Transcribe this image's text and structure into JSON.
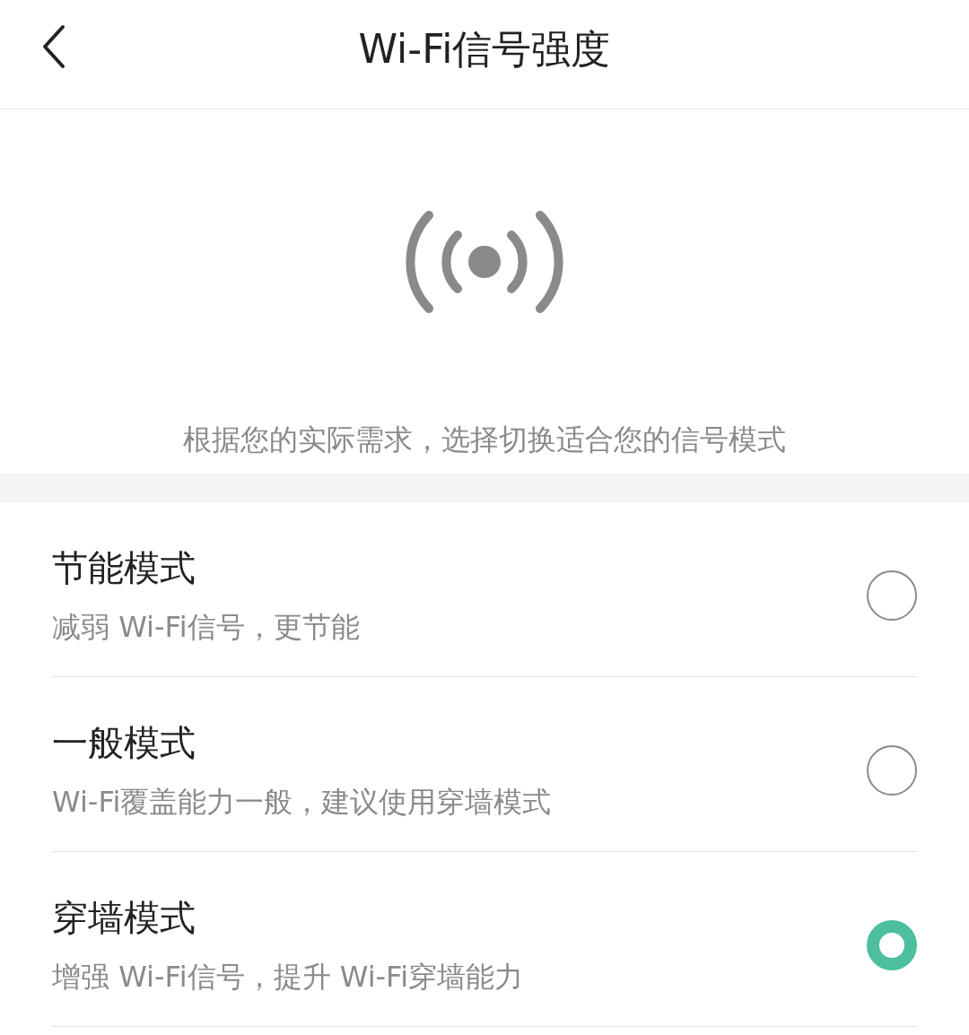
{
  "header": {
    "title": "Wi-Fi信号强度"
  },
  "description": "根据您的实际需求，选择切换适合您的信号模式",
  "modes": [
    {
      "title": "节能模式",
      "subtitle": "减弱 Wi-Fi信号，更节能",
      "selected": false
    },
    {
      "title": "一般模式",
      "subtitle": "Wi-Fi覆盖能力一般，建议使用穿墙模式",
      "selected": false
    },
    {
      "title": "穿墙模式",
      "subtitle": "增强 Wi-Fi信号，提升 Wi-Fi穿墙能力",
      "selected": true
    }
  ]
}
